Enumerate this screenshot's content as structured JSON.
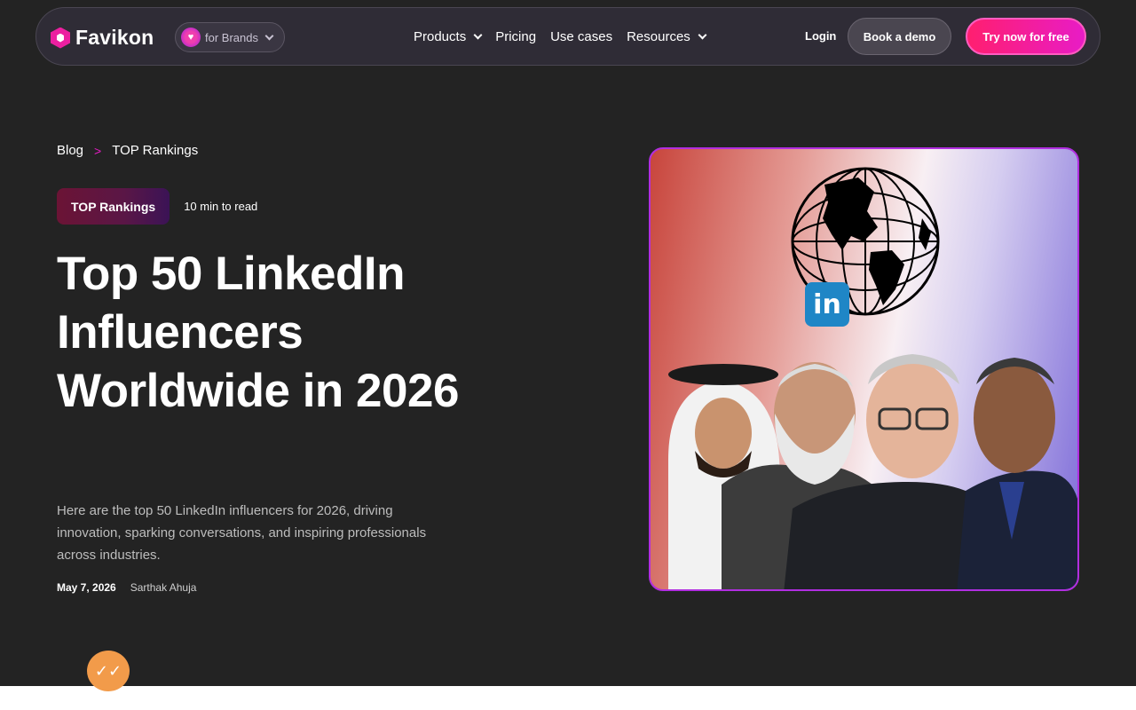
{
  "nav": {
    "logo_text": "Favikon",
    "brand_selector": "for Brands",
    "menu": [
      {
        "label": "Products",
        "has_dropdown": true
      },
      {
        "label": "Pricing",
        "has_dropdown": false
      },
      {
        "label": "Use cases",
        "has_dropdown": false
      },
      {
        "label": "Resources",
        "has_dropdown": true
      }
    ],
    "login": "Login",
    "demo": "Book a demo",
    "try": "Try now for free"
  },
  "breadcrumb": {
    "root": "Blog",
    "current": "TOP Rankings"
  },
  "article": {
    "tag": "TOP Rankings",
    "read_time": "10 min to read",
    "title": "Top 50 LinkedIn Influencers Worldwide in 2026",
    "description": "Here are the top 50 LinkedIn influencers for 2026, driving innovation, sparking conversations, and inspiring professionals across industries.",
    "date": "May 7, 2026",
    "author": "Sarthak Ahuja"
  },
  "hero_image": {
    "badge": "in"
  },
  "colors": {
    "accent": "#e81cc6",
    "cta": "#ff1f6f",
    "background": "#232323"
  },
  "icons": [
    "favikon-logo",
    "chevron-down-icon",
    "linkedin-icon",
    "globe-icon",
    "chat-icon"
  ]
}
